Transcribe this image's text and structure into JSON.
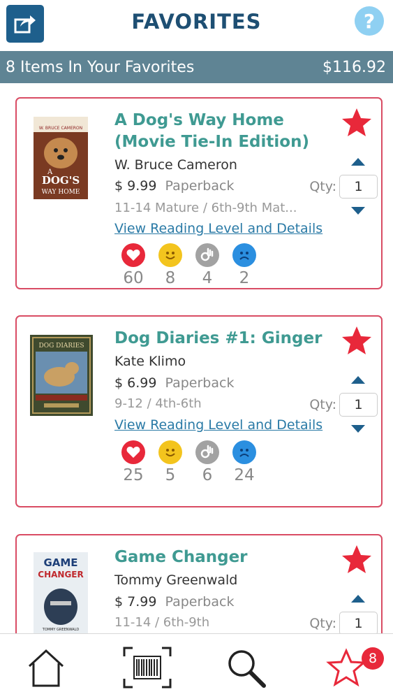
{
  "header": {
    "title": "FAVORITES",
    "help_label": "?"
  },
  "summary": {
    "count_text": "8 Items In Your Favorites",
    "total": "$116.92"
  },
  "colors": {
    "accent": "#1e5f8c",
    "title_teal": "#3f9a92",
    "card_border": "#d94c64",
    "summary_bar": "#5f8494",
    "star_red": "#e8283a"
  },
  "books": [
    {
      "title": "A Dog's Way Home (Movie Tie-In Edition)",
      "author": "W. Bruce Cameron",
      "price": "$ 9.99",
      "format": "Paperback",
      "levels": "11-14 Mature / 6th-9th Mat...",
      "link": "View Reading Level and Details",
      "qty_label": "Qty:",
      "qty": "1",
      "ratings": {
        "love": "60",
        "smile": "8",
        "ok": "4",
        "sad": "2"
      }
    },
    {
      "title": "Dog Diaries #1: Ginger",
      "author": "Kate Klimo",
      "price": "$ 6.99",
      "format": "Paperback",
      "levels": "9-12 / 4th-6th",
      "link": "View Reading Level and Details",
      "qty_label": "Qty:",
      "qty": "1",
      "ratings": {
        "love": "25",
        "smile": "5",
        "ok": "6",
        "sad": "24"
      }
    },
    {
      "title": "Game Changer",
      "author": "Tommy Greenwald",
      "price": "$ 7.99",
      "format": "Paperback",
      "levels": "11-14 / 6th-9th",
      "qty_label": "Qty:",
      "qty": "1"
    }
  ],
  "covers": [
    {
      "line1": "A",
      "line2": "DOG'S",
      "line3": "WAY HOME",
      "author": "W. BRUCE CAMERON"
    },
    {
      "line1": "DOG DIARIES"
    },
    {
      "line1": "GAME",
      "line2": "CHANGER",
      "author": "TOMMY GREENWALD"
    }
  ],
  "tabbar": {
    "icons": [
      "home-icon",
      "barcode-icon",
      "search-icon",
      "star-icon"
    ],
    "favorites_badge": "8"
  }
}
